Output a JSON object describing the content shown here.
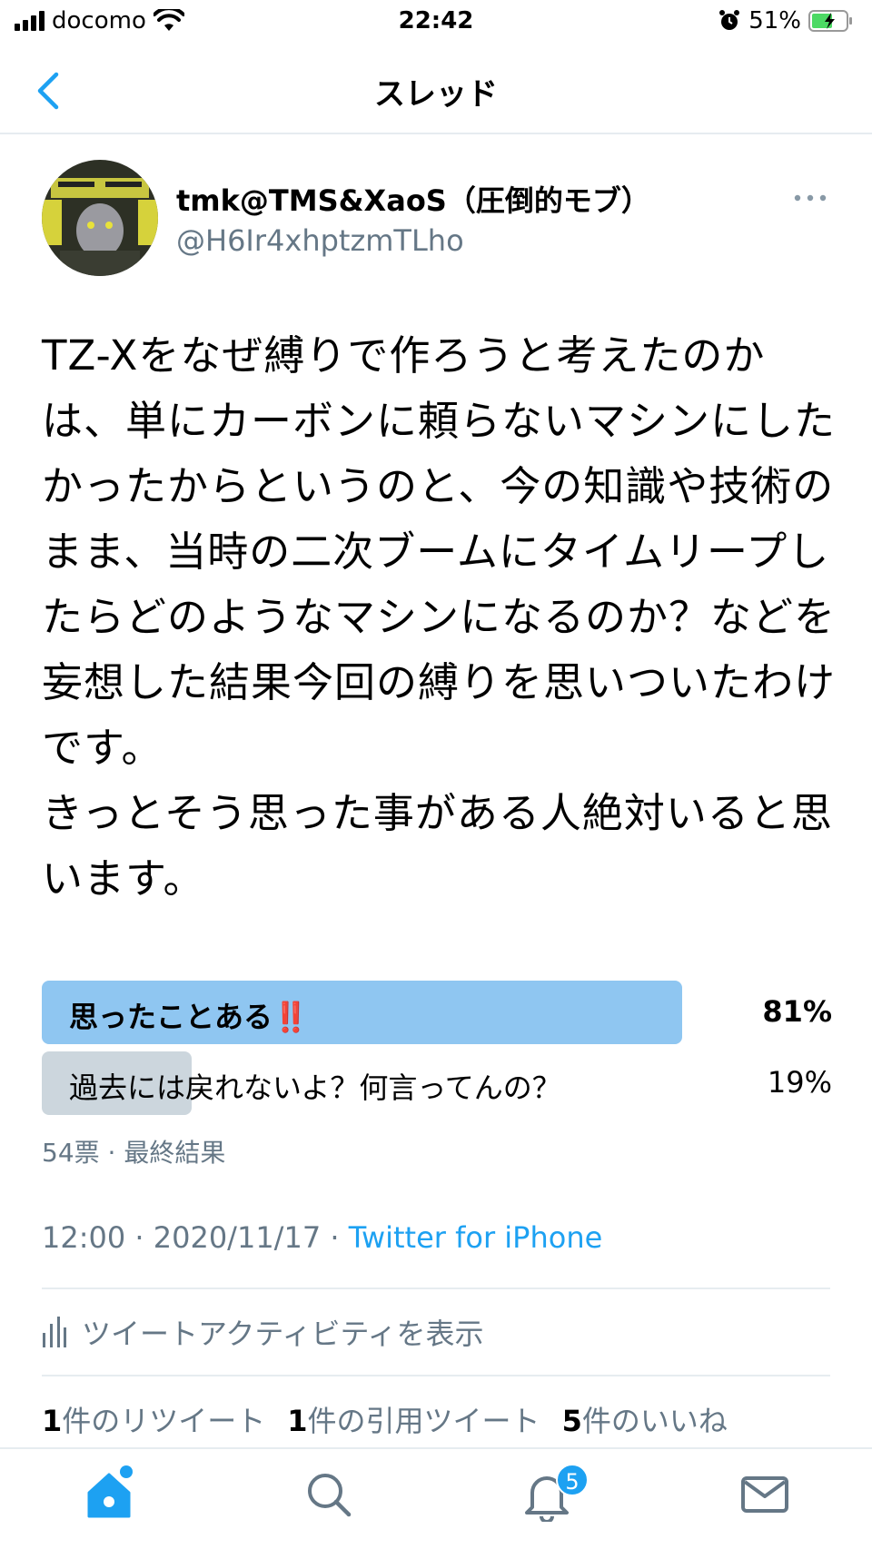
{
  "status_bar": {
    "carrier": "docomo",
    "time": "22:42",
    "battery_percent": "51%"
  },
  "nav": {
    "title": "スレッド",
    "back_icon": "chevron-left-icon"
  },
  "tweet": {
    "user_name": "tmk@TMS&XaoS（圧倒的モブ）",
    "handle": "@H6Ir4xhptzmTLho",
    "text": "TZ-Xをなぜ縛りで作ろうと考えたのかは、単にカーボンに頼らないマシンにしたかったからというのと、今の知識や技術のまま、当時の二次ブームにタイムリープしたらどのようなマシンになるのか？などを妄想した結果今回の縛りを思いついたわけです。\nきっとそう思った事がある人絶対いると思います。",
    "poll": {
      "options": [
        {
          "label": "思ったことある",
          "suffix": "‼️",
          "percent": "81%",
          "fraction": 0.81
        },
        {
          "label": "過去には戻れないよ？何言ってんの？",
          "percent": "19%",
          "fraction": 0.19
        }
      ],
      "summary": "54票 · 最終結果"
    },
    "timestamp": "12:00 · 2020/11/17 · ",
    "source": "Twitter for iPhone",
    "activity_label": "ツイートアクティビティを表示",
    "stats": {
      "retweets_count": "1",
      "retweets_label": "件のリツイート",
      "quotes_count": "1",
      "quotes_label": "件の引用ツイート",
      "likes_count": "5",
      "likes_label": "件のいいね"
    }
  },
  "tab_bar": {
    "notifications_badge": "5"
  },
  "colors": {
    "accent": "#1da1f2",
    "poll_winner": "#8fc6f1",
    "poll_other": "#ccd6dd",
    "secondary_text": "#657786"
  }
}
